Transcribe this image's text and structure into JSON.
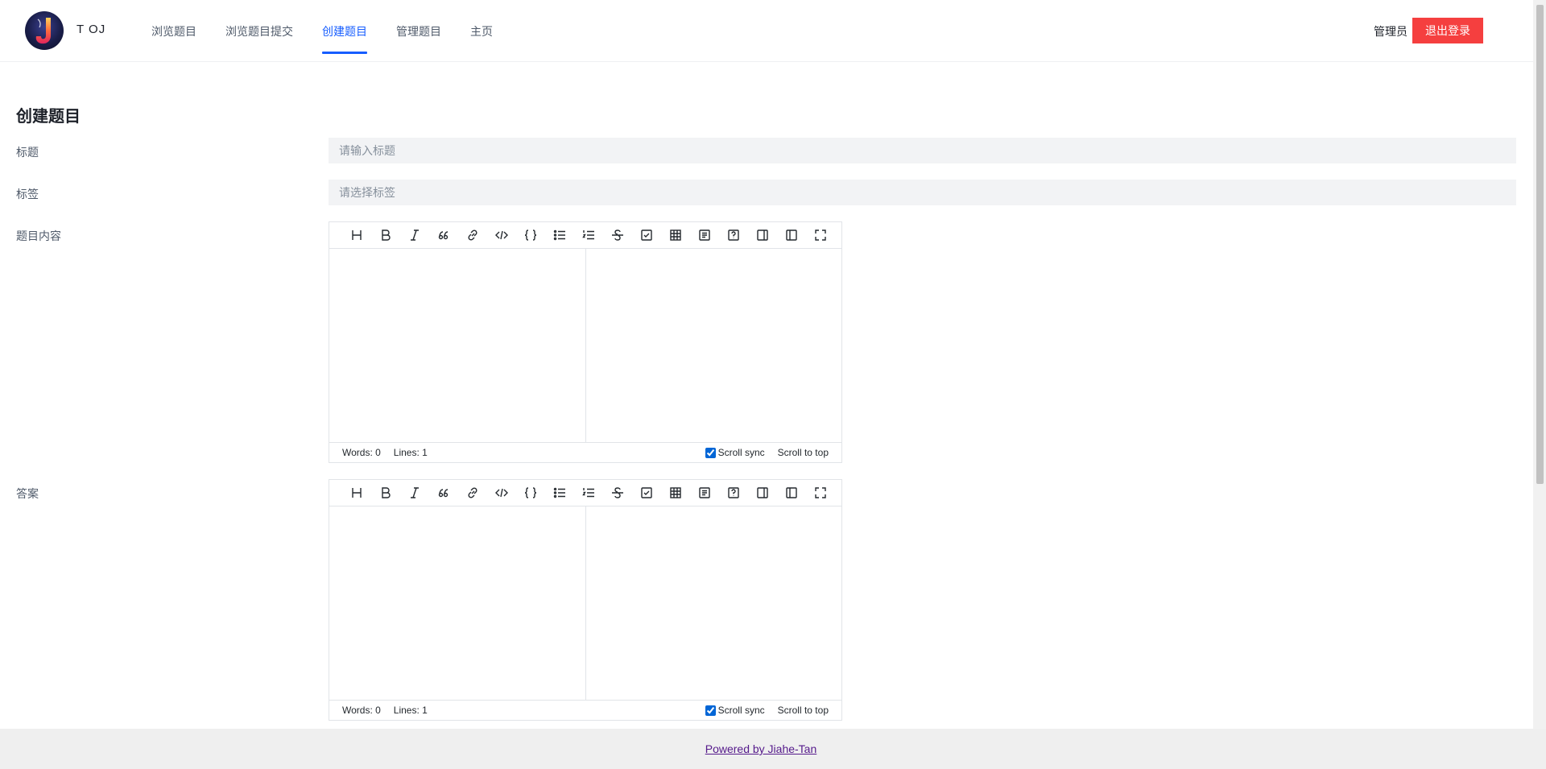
{
  "header": {
    "brand": "T OJ",
    "nav": [
      {
        "label": "浏览题目",
        "active": false
      },
      {
        "label": "浏览题目提交",
        "active": false
      },
      {
        "label": "创建题目",
        "active": true
      },
      {
        "label": "管理题目",
        "active": false
      },
      {
        "label": "主页",
        "active": false
      }
    ],
    "user_name": "管理员",
    "logout_label": "退出登录"
  },
  "form": {
    "title": "创建题目",
    "title_label": "标题",
    "title_placeholder": "请输入标题",
    "tags_label": "标签",
    "tags_placeholder": "请选择标签",
    "content_label": "题目内容",
    "answer_label": "答案"
  },
  "editor": {
    "tools": [
      "heading-icon",
      "bold-icon",
      "italic-icon",
      "quote-icon",
      "link-icon",
      "code-icon",
      "code-block-icon",
      "unordered-list-icon",
      "ordered-list-icon",
      "strikethrough-icon",
      "task-list-icon",
      "table-icon",
      "toc-icon",
      "help-icon",
      "preview-only-icon",
      "split-view-icon",
      "fullscreen-icon"
    ],
    "words": "Words: 0",
    "lines": "Lines: 1",
    "scroll_sync": "Scroll sync",
    "scroll_top": "Scroll to top"
  },
  "footer": {
    "link": "Powered by Jiahe-Tan"
  },
  "colors": {
    "accent": "#165dff",
    "danger": "#f53f3f"
  }
}
